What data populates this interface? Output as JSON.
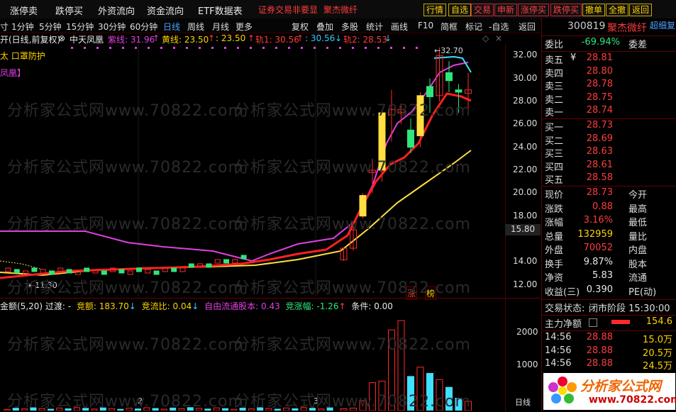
{
  "nav": {
    "items": [
      "涨停卖",
      "跌停买",
      "外资流向",
      "资金流向",
      "ETF数据表"
    ],
    "stock_tab": "证券交易非要显",
    "stock_name": "聚杰微纤",
    "buttons": [
      "行情",
      "自选",
      "交易",
      "申新",
      "涨停买",
      "跌停买",
      "撤单",
      "全撤",
      "返回"
    ]
  },
  "period": {
    "items": [
      "寸",
      "1分钟",
      "5分钟",
      "15分钟",
      "30分钟",
      "60分钟",
      "日线",
      "周线",
      "月线",
      "更多",
      "复权",
      "叠加",
      "多股",
      "统计",
      "画线",
      "F10",
      "简框",
      "标记",
      "-自选",
      "返回"
    ],
    "active": "日线"
  },
  "legend": {
    "prefix": "开(日线,前复权)",
    "name": "中天凤凰",
    "purple": "紫线: 31.96",
    "yellow": "黄线: 23.50",
    "yellow2": ": 23.50",
    "track1": "轨1: 30.56",
    "track1b": ": 30.56",
    "track2": "轨2: 28.53"
  },
  "chart_labels": {
    "line2": "太 口罩防护",
    "line3": "凤凰】",
    "high_label": "32.70",
    "low_label": "11.30",
    "zhang": "涨",
    "bang": "榜",
    "cursor_price": "15.80"
  },
  "chart_data": {
    "type": "candlestick",
    "ylim": [
      11,
      33
    ],
    "yticks": [
      12.0,
      14.0,
      16.0,
      18.0,
      20.0,
      22.0,
      24.0,
      26.0,
      28.0,
      30.0,
      32.0
    ],
    "ytick_labels": [
      "12.00",
      "14.00",
      "",
      "18.00",
      "20.00",
      "22.00",
      "24.00",
      "26.00",
      "28.00",
      "30.00",
      "32.00"
    ],
    "vol_yticks": [
      1000,
      2000
    ],
    "vol_xlabels": [
      "2",
      "3"
    ],
    "candles_recent": [
      {
        "o": 14.2,
        "c": 15.2,
        "h": 15.3,
        "l": 14.1,
        "v": 60,
        "up": true
      },
      {
        "o": 15.2,
        "c": 16.8,
        "h": 17.0,
        "l": 15.0,
        "v": 80,
        "up": true
      },
      {
        "o": 18.0,
        "c": 19.8,
        "h": 20.0,
        "l": 17.8,
        "v": 320,
        "up": true
      },
      {
        "o": 22.0,
        "c": 21.8,
        "h": 23.0,
        "l": 20.0,
        "v": 900,
        "up": true
      },
      {
        "o": 22.0,
        "c": 27.0,
        "h": 27.2,
        "l": 21.0,
        "v": 950,
        "up": true
      },
      {
        "o": 26.8,
        "c": 27.3,
        "h": 29.0,
        "l": 24.5,
        "v": 2600,
        "up": true
      },
      {
        "o": 27.3,
        "c": 27.0,
        "h": 27.8,
        "l": 26.0,
        "v": 2900,
        "up": true
      },
      {
        "o": 24.0,
        "c": 25.5,
        "h": 26.5,
        "l": 23.5,
        "v": 1100,
        "up": false
      },
      {
        "o": 25.0,
        "c": 28.5,
        "h": 28.8,
        "l": 24.0,
        "v": 1400,
        "up": true
      },
      {
        "o": 28.4,
        "c": 29.3,
        "h": 30.0,
        "l": 27.0,
        "v": 1200,
        "up": false
      },
      {
        "o": 28.5,
        "c": 32.0,
        "h": 32.7,
        "l": 28.0,
        "v": 1000,
        "up": true
      },
      {
        "o": 29.8,
        "c": 30.5,
        "h": 31.5,
        "l": 28.8,
        "v": 750,
        "up": false
      },
      {
        "o": 29.0,
        "c": 28.8,
        "h": 29.5,
        "l": 27.0,
        "v": 400,
        "up": false
      },
      {
        "o": 29.0,
        "c": 28.7,
        "h": 30.5,
        "l": 27.2,
        "v": 300,
        "up": true
      }
    ]
  },
  "indicator": {
    "label": "金额(5,20) 过渡: -",
    "jing_e": "竞额: 183.70",
    "jing_liu": "竞流比: 0.04",
    "free_float": "自由流通股本: 0.43",
    "jing_zhang": "竞涨幅: -1.26",
    "cond": "条件: 0.00"
  },
  "quote": {
    "code": "300819",
    "name": "聚杰微纤",
    "corner": "超细复",
    "weibi_label": "委比",
    "weibi_val": "-69.94%",
    "weicha_label": "委差",
    "sell": [
      {
        "label": "卖五",
        "price": "28.81"
      },
      {
        "label": "卖四",
        "price": "28.80"
      },
      {
        "label": "卖三",
        "price": "28.78"
      },
      {
        "label": "卖二",
        "price": "28.75"
      },
      {
        "label": "卖一",
        "price": "28.74"
      }
    ],
    "buy": [
      {
        "label": "买一",
        "price": "28.73"
      },
      {
        "label": "买二",
        "price": "28.69"
      },
      {
        "label": "买三",
        "price": "28.63"
      },
      {
        "label": "买四",
        "price": "28.61"
      },
      {
        "label": "买五",
        "price": "28.58"
      }
    ],
    "stats": [
      {
        "l1": "现价",
        "v1": "28.73",
        "l2": "今开"
      },
      {
        "l1": "涨跌",
        "v1": "0.88",
        "l2": "最高"
      },
      {
        "l1": "涨幅",
        "v1": "3.16%",
        "l2": "最低"
      },
      {
        "l1": "总量",
        "v1": "132959",
        "l2": "量比"
      },
      {
        "l1": "外盘",
        "v1": "70052",
        "l2": "内盘"
      },
      {
        "l1": "换手",
        "v1": "9.87%",
        "l2": "股本"
      },
      {
        "l1": "净资",
        "v1": "5.83",
        "l2": "流通"
      },
      {
        "l1": "收益(三)",
        "v1": "0.390",
        "l2": "PE(动)"
      }
    ],
    "trade_status_label": "交易状态:",
    "trade_status": "闭市阶段 15:30:00",
    "main_net_label": "主力净额",
    "main_net_value": "154.6",
    "ticks": [
      {
        "time": "14:56",
        "price": "28.88",
        "qty": "15.0万"
      },
      {
        "time": "14:56",
        "price": "28.88",
        "qty": "20.5万"
      },
      {
        "time": "14:56",
        "price": "28.88",
        "qty": "24.5万"
      }
    ],
    "logo_text": "分析家公式网",
    "logo_url": "www.70822.com"
  },
  "watermark": "分析家公式网www.70822.com",
  "colors": {
    "red": "#ff2a2a",
    "green": "#2fe67a",
    "yellow": "#ffe040",
    "purple": "#e040e0",
    "cyan": "#40e0ff"
  }
}
